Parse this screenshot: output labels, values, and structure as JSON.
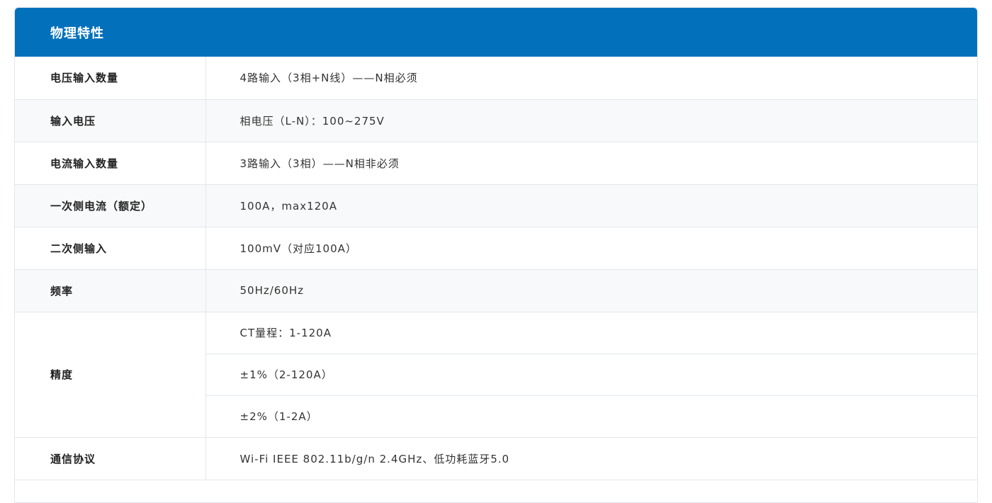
{
  "section": {
    "title": "物理特性"
  },
  "specs": [
    {
      "label": "电压输入数量",
      "value": "4路输入（3相+N线）——N相必须"
    },
    {
      "label": "输入电压",
      "value": "相电压（L-N）：100~275V"
    },
    {
      "label": "电流输入数量",
      "value": "3路输入（3相）——N相非必须"
    },
    {
      "label": "一次侧电流（额定）",
      "value": "100A，max120A"
    },
    {
      "label": "二次侧输入",
      "value": "100mV（对应100A）"
    },
    {
      "label": "频率",
      "value": "50Hz/60Hz"
    }
  ],
  "precision": {
    "label": "精度",
    "values": [
      "CT量程：1-120A",
      "±1%（2-120A）",
      "±2%（1-2A）"
    ]
  },
  "protocol": {
    "label": "通信协议",
    "value": "Wi-Fi IEEE 802.11b/g/n 2.4GHz、低功耗蓝牙5.0"
  },
  "colors": {
    "header_bg": "#0270bb",
    "row_alt_bg": "#f8f9fa",
    "border": "#e3e6ea"
  }
}
